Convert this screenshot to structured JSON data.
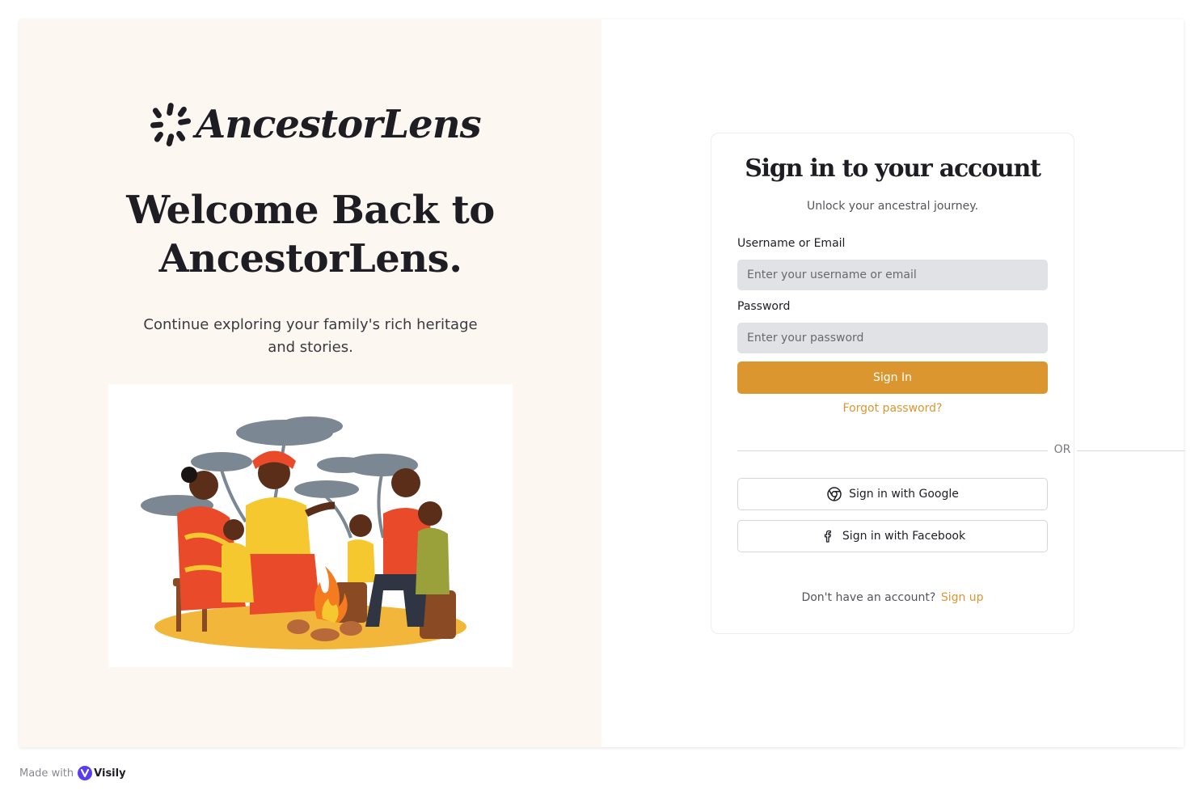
{
  "brand": {
    "name": "AncestorLens",
    "logo_icon": "asterisk-spark-icon"
  },
  "hero": {
    "headline": "Welcome Back to AncestorLens.",
    "tagline": "Continue exploring your family's rich heritage and stories.",
    "illustration": "family-around-campfire-illustration"
  },
  "signin": {
    "title": "Sign in to your account",
    "subtitle": "Unlock your ancestral journey.",
    "username_label": "Username or Email",
    "username_placeholder": "Enter your username or email",
    "username_value": "",
    "password_label": "Password",
    "password_placeholder": "Enter your password",
    "password_value": "",
    "signin_button": "Sign In",
    "forgot_link": "Forgot password?",
    "divider_text": "OR",
    "google_button": "Sign in with Google",
    "google_icon": "chrome-icon",
    "facebook_button": "Sign in with Facebook",
    "facebook_icon": "facebook-icon",
    "no_account_text": "Don't have an account?",
    "signup_link": "Sign up"
  },
  "footer": {
    "made_with": "Made with",
    "visily": "Visily"
  },
  "colors": {
    "accent": "#db962f",
    "left_bg": "#fcf7f1",
    "input_bg": "#e0e2e6",
    "text_dark": "#1f1d24"
  }
}
